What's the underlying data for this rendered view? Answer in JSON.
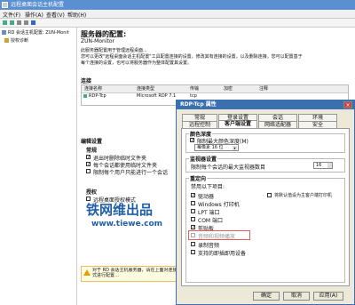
{
  "window": {
    "title": "远程桌面会话主机配置"
  },
  "menu": [
    {
      "label": "文件(F)"
    },
    {
      "label": "操作(A)"
    },
    {
      "label": "查看(V)"
    },
    {
      "label": "帮助(H)"
    }
  ],
  "tree": {
    "root": "RD 会话主机配置: ZUN-Monit",
    "child": "授权诊断"
  },
  "main": {
    "title": "服务器的配置:",
    "server_name": "ZUN-Monitor",
    "desc1": "此服务器配置用于管理远程桌面...",
    "desc2": "您可以更改\"远程桌面会话主机配置\"工具配置连接的设置，修改其有连接的设置，以及删除连接。您可以配置基于",
    "desc3": "每个连接的设置，也可以将服务器作为整体配置其设置。",
    "connections_label": "连接",
    "table_headers": [
      "连接名称",
      "连接类型",
      "传输",
      "加密",
      "注释"
    ],
    "table_row": [
      "RDP-Tcp",
      "Microsoft RDP 7.1",
      "tcp",
      "",
      ""
    ],
    "edit_label": "编辑设置",
    "general_label": "常规",
    "general_items": [
      {
        "label": "退出时删除临时文件夹",
        "checked": true
      },
      {
        "label": "每个会话都使用临时文件夹",
        "checked": true
      },
      {
        "label": "限制每个用户只能进行一个会话",
        "checked": false
      }
    ],
    "licensing_label": "授权",
    "licensing_item": "远程桌面授权模式",
    "bottom_warning": "对于 RD 会话主机服务器，请在上面对连接方式进行配置…"
  },
  "dialog": {
    "title": "RDP-Tcp 属性",
    "tabs_row1": [
      "常规",
      "登录设置",
      "会话",
      "环境"
    ],
    "tabs_row2": [
      "远程控制",
      "客户端设置",
      "网络适配器",
      "安全"
    ],
    "color_group": "颜色深度",
    "color_checkbox": "限制最大颜色深度(M)",
    "color_value": "每像素 16 位",
    "monitor_group": "监视器设置",
    "monitor_label": "限制每个会话的最大监视器数目",
    "monitor_value": "16",
    "redirect_group": "重定向",
    "redirect_sub": "禁用以下项目:",
    "left_items": [
      {
        "label": "驱动器",
        "checked": true
      },
      {
        "label": "Windows 打印机",
        "checked": false
      },
      {
        "label": "LPT 端口",
        "checked": false
      },
      {
        "label": "COM 端口",
        "checked": false
      },
      {
        "label": "剪贴板",
        "checked": true
      },
      {
        "label": "音频和视频播放",
        "checked": false,
        "disabled": true
      },
      {
        "label": "录制音频",
        "checked": false
      },
      {
        "label": "支持的即插即用设备",
        "checked": false
      }
    ],
    "right_item": "将默认值设为主客户端打印机",
    "buttons": {
      "ok": "确定",
      "cancel": "取消",
      "apply": "应用(A)"
    }
  },
  "watermark": {
    "line1": "铁网维出品",
    "line2": "www.tiewe.com"
  },
  "colors": {
    "accent": "#1f5fa8",
    "highlight_box": "#e06060"
  }
}
